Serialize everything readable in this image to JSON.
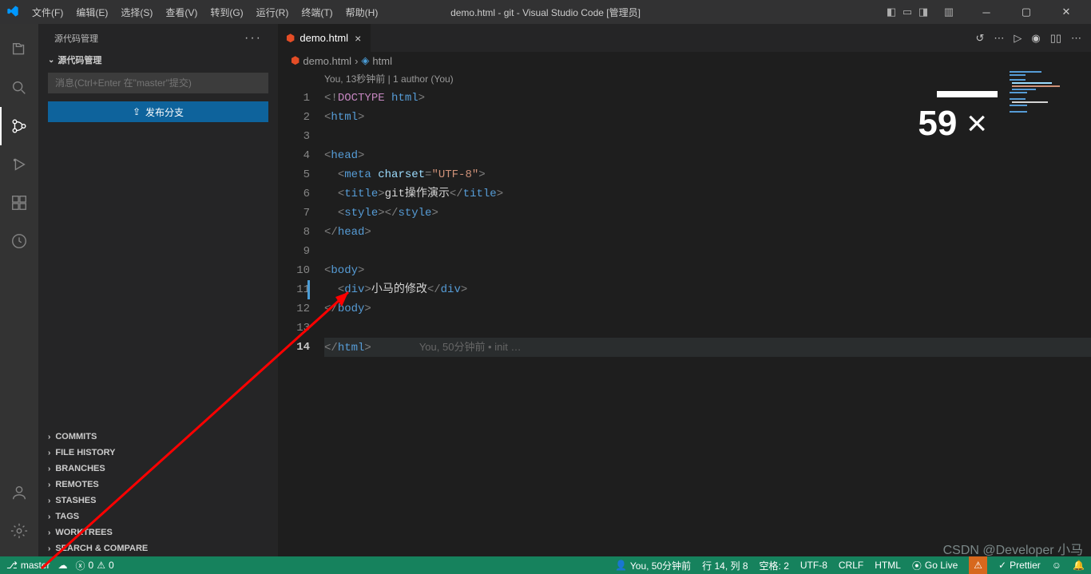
{
  "titlebar": {
    "menu": [
      "文件(F)",
      "编辑(E)",
      "选择(S)",
      "查看(V)",
      "转到(G)",
      "运行(R)",
      "终端(T)",
      "帮助(H)"
    ],
    "title": "demo.html - git - Visual Studio Code [管理员]"
  },
  "sidebar": {
    "header": "源代码管理",
    "section": "源代码管理",
    "commit_placeholder": "消息(Ctrl+Enter 在\"master\"提交)",
    "publish_label": "发布分支",
    "bottom_sections": [
      "COMMITS",
      "FILE HISTORY",
      "BRANCHES",
      "REMOTES",
      "STASHES",
      "TAGS",
      "WORKTREES",
      "SEARCH & COMPARE"
    ]
  },
  "tab": {
    "filename": "demo.html"
  },
  "breadcrumb": {
    "file": "demo.html",
    "symbol": "html"
  },
  "codelens": "You, 13秒钟前 | 1 author (You)",
  "blame_current": "You, 50分钟前 • init …",
  "code": {
    "line1": {
      "doctype": "DOCTYPE",
      "html": "html"
    },
    "line2": {
      "tag": "html"
    },
    "line4": {
      "tag": "head"
    },
    "line5": {
      "tag": "meta",
      "attr": "charset",
      "val": "\"UTF-8\""
    },
    "line6": {
      "tag": "title",
      "text": "git操作演示"
    },
    "line7": {
      "tag": "style"
    },
    "line8": {
      "tag": "head"
    },
    "line10": {
      "tag": "body"
    },
    "line11": {
      "tag": "div",
      "text": "小马的修改"
    },
    "line12": {
      "tag": "body"
    },
    "line14": {
      "tag": "html"
    }
  },
  "line_numbers": [
    "1",
    "2",
    "3",
    "4",
    "5",
    "6",
    "7",
    "8",
    "9",
    "10",
    "11",
    "12",
    "13",
    "14"
  ],
  "statusbar": {
    "branch": "master",
    "errors": "0",
    "warnings": "0",
    "blame": "You, 50分钟前",
    "position": "行 14, 列 8",
    "spaces": "空格: 2",
    "encoding": "UTF-8",
    "eol": "CRLF",
    "lang": "HTML",
    "golive": "Go Live",
    "prettier": "Prettier"
  },
  "overlay": {
    "zoom": "59",
    "x": "×"
  },
  "watermark": "CSDN @Developer 小马"
}
